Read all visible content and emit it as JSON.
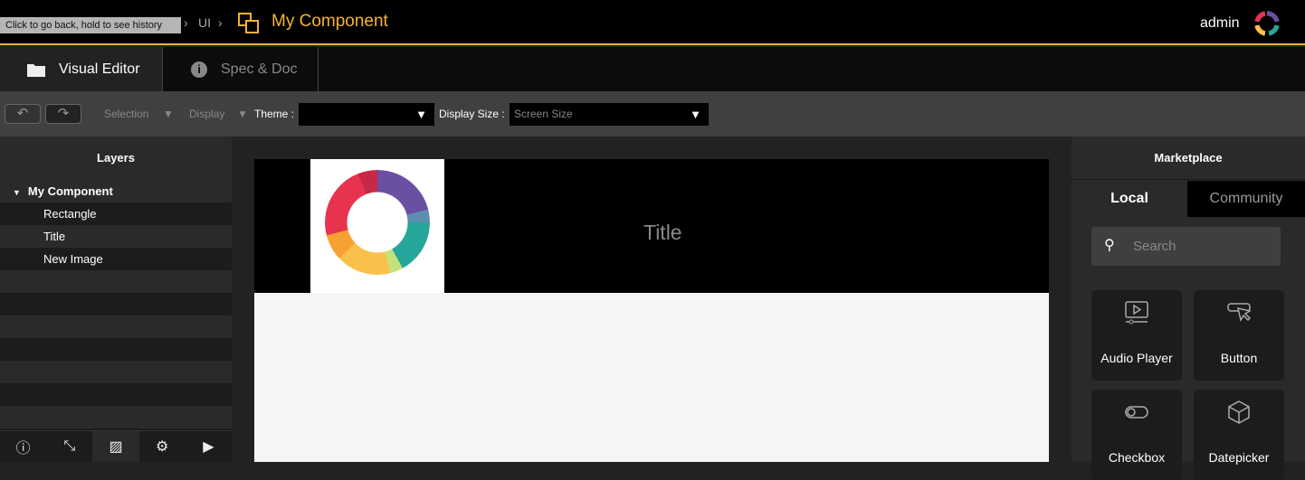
{
  "header": {
    "tooltip": "Click to go back, hold to see history",
    "breadcrumb": [
      "UI"
    ],
    "title": "My Component",
    "user": "admin",
    "accent": "#f5b335"
  },
  "tabs": [
    {
      "label": "Visual Editor",
      "icon": "folder-icon"
    },
    {
      "label": "Spec & Doc",
      "icon": "info-icon"
    }
  ],
  "toolbar": {
    "undo": "↶",
    "redo": "↷",
    "selection": "Selection",
    "display": "Display",
    "theme_label": "Theme :",
    "theme_value": "",
    "display_size_label": "Display Size :",
    "display_size_value": "Screen Size"
  },
  "layers": {
    "title": "Layers",
    "root": "My Component",
    "items": [
      "Rectangle",
      "Title",
      "New Image"
    ]
  },
  "canvas": {
    "title": "Title"
  },
  "marketplace": {
    "title": "Marketplace",
    "tabs": [
      "Local",
      "Community"
    ],
    "search_placeholder": "Search",
    "items": [
      "Audio Player",
      "Button",
      "Checkbox",
      "Datepicker"
    ]
  }
}
